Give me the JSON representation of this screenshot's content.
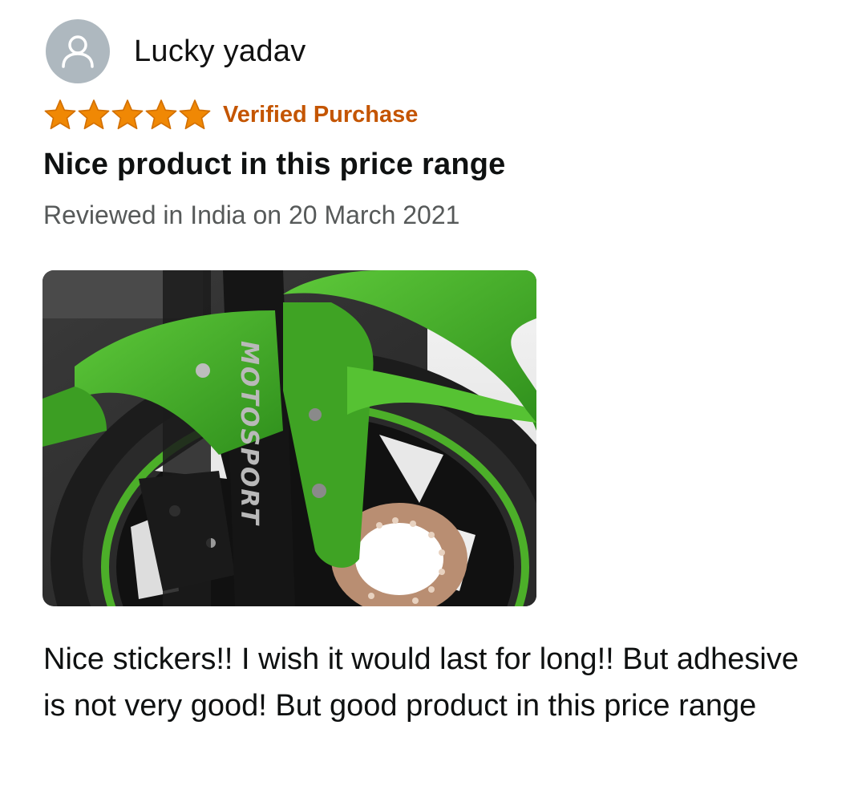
{
  "reviewer": {
    "name": "Lucky yadav",
    "avatar_icon": "user-silhouette-icon"
  },
  "rating": {
    "stars": 5,
    "max_stars": 5,
    "star_color": "#f08804",
    "star_icon": "star-icon",
    "verified_label": "Verified Purchase",
    "verified_color": "#c45500"
  },
  "review": {
    "title": "Nice product in this price range",
    "date_text": "Reviewed in India on 20 March 2021",
    "image": {
      "fork_text": "MOTOSPORT",
      "main_color": "#4caf29"
    },
    "body": "Nice stickers!! I wish it would last for long!! But adhesive is not very good! But good product in this price range"
  }
}
